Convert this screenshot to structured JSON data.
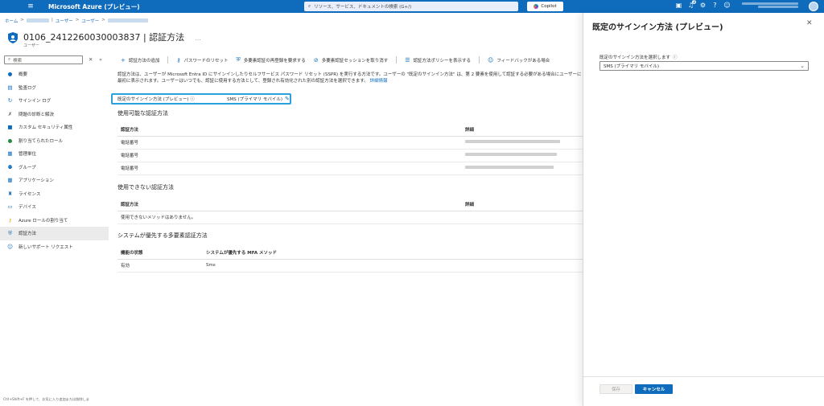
{
  "topbar": {
    "menu_icon": "hamburger-icon",
    "brand": "Microsoft Azure (プレビュー)",
    "search_placeholder": "リソース、サービス、ドキュメントの検索 (G+/)",
    "copilot": "Copilot",
    "notification_count": "2"
  },
  "breadcrumb": {
    "home": "ホーム",
    "users": "ユーザー"
  },
  "page": {
    "title": "0106_2412260030003837 | 認証方法",
    "more": "…",
    "subtitle": "ユーザー"
  },
  "sidebar": {
    "search_placeholder": "検索",
    "footer": "Ctrl+Shift+F を押して、お気に入り追加または削除しま",
    "items": [
      {
        "label": "概要",
        "icon": "user-icon"
      },
      {
        "label": "監査ログ",
        "icon": "log-icon"
      },
      {
        "label": "サインイン ログ",
        "icon": "signin-icon"
      },
      {
        "label": "問題の診断と解決",
        "icon": "wrench-icon"
      },
      {
        "label": "カスタム セキュリティ属性",
        "icon": "tag-icon"
      },
      {
        "label": "割り当てられたロール",
        "icon": "role-icon"
      },
      {
        "label": "管理単位",
        "icon": "admin-unit-icon"
      },
      {
        "label": "グループ",
        "icon": "group-icon"
      },
      {
        "label": "アプリケーション",
        "icon": "apps-icon"
      },
      {
        "label": "ライセンス",
        "icon": "license-icon"
      },
      {
        "label": "デバイス",
        "icon": "device-icon"
      },
      {
        "label": "Azure ロールの割り当て",
        "icon": "key-icon"
      },
      {
        "label": "認証方法",
        "icon": "shield-icon"
      },
      {
        "label": "新しいサポート リクエスト",
        "icon": "support-icon"
      }
    ]
  },
  "toolbar": {
    "add": "認証方法の追加",
    "reset_password": "パスワードのリセット",
    "require_mfa": "多要素認証の再登録を要求する",
    "revoke_mfa": "多要素認証セッションを取り消す",
    "show_policy": "認証方法ポリシーを表示する",
    "feedback": "フィードバックがある場合"
  },
  "description": {
    "text": "認証方法は、ユーザーが Microsoft Entra ID にサインインしたりセルフサービス パスワード リセット (SSPR) を実行する方法です。ユーザーの \"既定のサインイン方法\" は、第 2 要素を使用して認証する必要がある場合にユーザーに最初に表示されます。ユーザーはいつでも、認証に使用する方法として、登録され有効化された別の認証方法を選択できます。",
    "link": "詳細情報"
  },
  "default_method": {
    "label": "既定のサインイン方法 (プレビュー)",
    "value": "SMS (プライマリ モバイル)"
  },
  "usable": {
    "heading": "使用可能な認証方法",
    "col_method": "認証方法",
    "col_detail": "詳細",
    "rows": [
      {
        "method": "電話番号"
      },
      {
        "method": "電話番号"
      },
      {
        "method": "電話番号"
      }
    ]
  },
  "unusable": {
    "heading": "使用できない認証方法",
    "col_method": "認証方法",
    "col_detail": "詳細",
    "empty": "使用できないメソッドはありません。"
  },
  "system_mfa": {
    "heading": "システムが優先する多要素認証方法",
    "col_state": "機能の状態",
    "col_method": "システムが優先する MFA メソッド",
    "state": "有効",
    "method": "Sms"
  },
  "panel": {
    "title": "既定のサインイン方法 (プレビュー)",
    "select_label": "既定のサインイン方法を選択します",
    "select_value": "SMS (プライマリ モバイル)",
    "save": "保存",
    "cancel": "キャンセル"
  },
  "colors": {
    "azure_blue": "#0f6cbd",
    "highlight_border": "#2aa0dc"
  }
}
